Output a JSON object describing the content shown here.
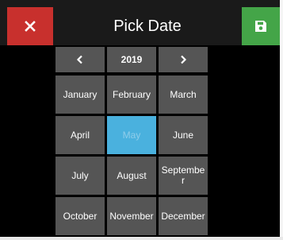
{
  "dialog": {
    "title": "Pick Date",
    "cancel_icon": "close-icon",
    "save_icon": "floppy-disk-icon",
    "colors": {
      "background": "#000000",
      "header": "#1a1a1a",
      "cancel": "#c8302d",
      "save": "#44a548",
      "cell": "#555555",
      "selected": "#4ab1de"
    }
  },
  "nav": {
    "prev_glyph": "<",
    "year": "2019",
    "next_glyph": ">"
  },
  "months": [
    [
      "January",
      "February",
      "March"
    ],
    [
      "April",
      "May",
      "June"
    ],
    [
      "July",
      "August",
      "Septembe r"
    ],
    [
      "October",
      "November",
      "December"
    ]
  ],
  "selected_month": "May"
}
